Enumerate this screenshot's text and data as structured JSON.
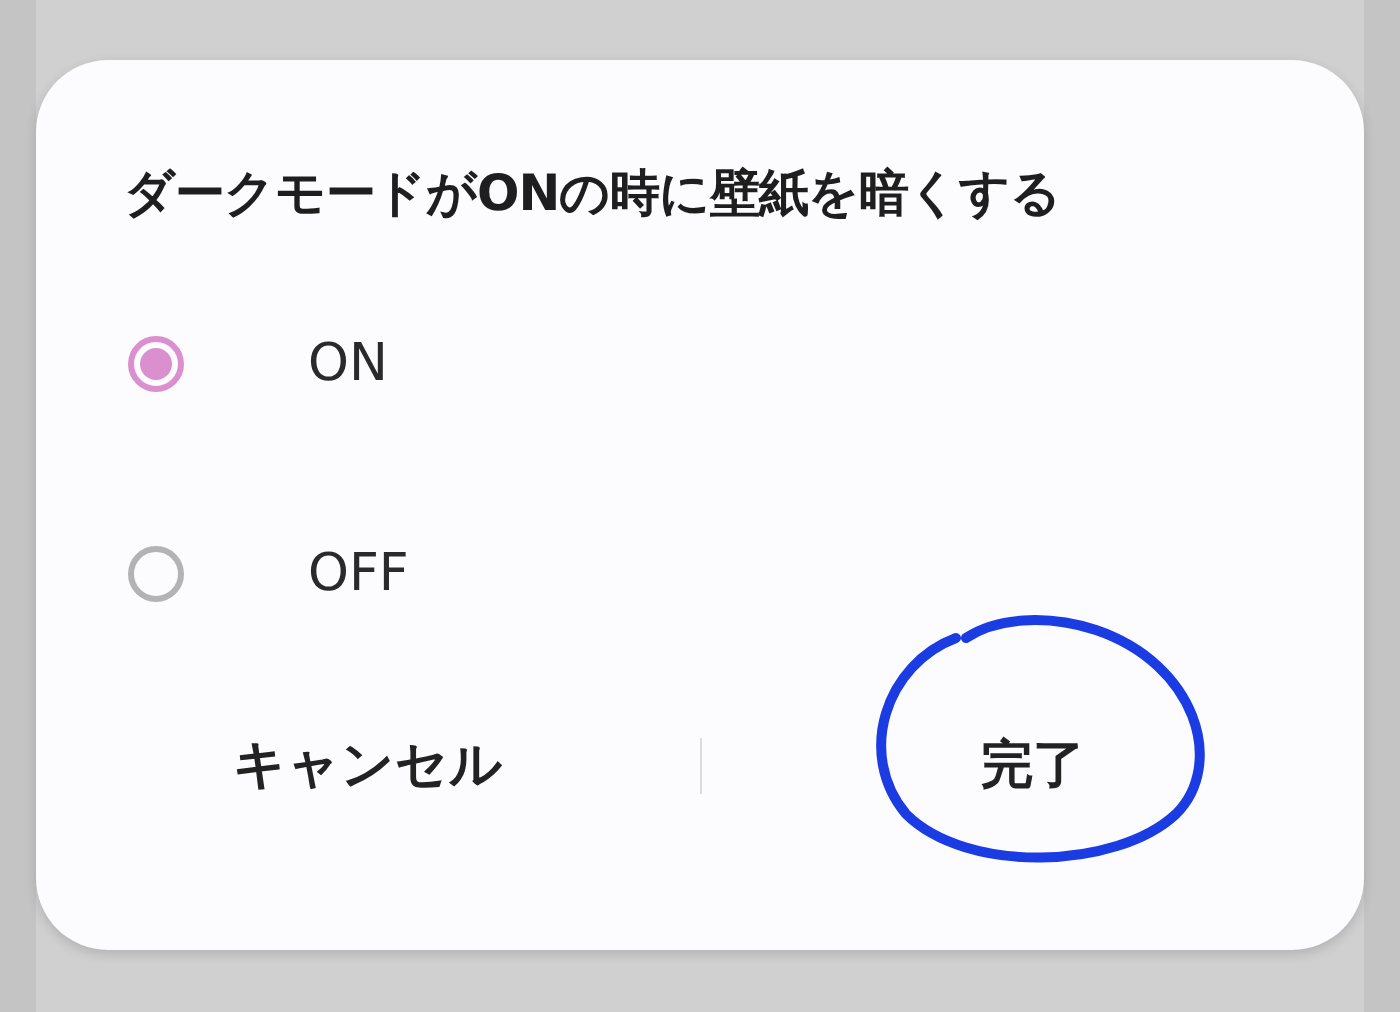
{
  "dialog": {
    "title": "ダークモードがONの時に壁紙を暗くする",
    "options": [
      {
        "label": "ON",
        "selected": true
      },
      {
        "label": "OFF",
        "selected": false
      }
    ],
    "buttons": [
      {
        "label": "キャンセル",
        "annotated": false
      },
      {
        "label": "完了",
        "annotated": true
      }
    ]
  }
}
